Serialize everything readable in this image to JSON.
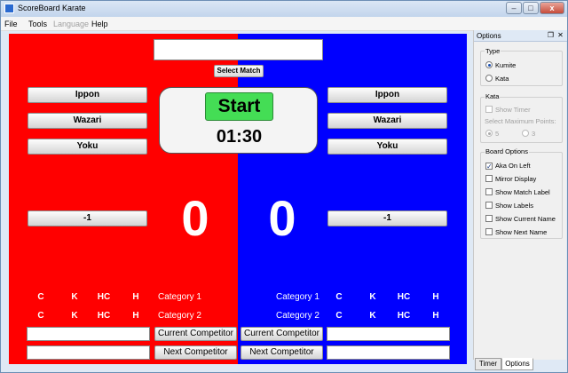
{
  "window": {
    "title": "ScoreBoard Karate",
    "min": "–",
    "max": "□",
    "close": "x"
  },
  "menu": {
    "file": "File",
    "tools": "Tools",
    "language": "Language",
    "help": "Help"
  },
  "board": {
    "select_match": "Select Match",
    "start": "Start",
    "timer": "01:30",
    "red": {
      "ippon": "Ippon",
      "wazari": "Wazari",
      "yoku": "Yoku",
      "minus": "-1",
      "score": "0",
      "penalties1": [
        "C",
        "K",
        "HC",
        "H"
      ],
      "penalties2": [
        "C",
        "K",
        "HC",
        "H"
      ],
      "category1": "Category 1",
      "category2": "Category 2",
      "current_button": "Current Competitor",
      "next_button": "Next Competitor"
    },
    "blue": {
      "ippon": "Ippon",
      "wazari": "Wazari",
      "yoku": "Yoku",
      "minus": "-1",
      "score": "0",
      "penalties1": [
        "C",
        "K",
        "HC",
        "H"
      ],
      "penalties2": [
        "C",
        "K",
        "HC",
        "H"
      ],
      "category1": "Category 1",
      "category2": "Category 2",
      "current_button": "Current Competitor",
      "next_button": "Next Competitor"
    },
    "colors": {
      "red": "#ff0000",
      "blue": "#0000ff",
      "start": "#44dd55"
    }
  },
  "options": {
    "title": "Options",
    "type_group": "Type",
    "kumite": "Kumite",
    "kata": "Kata",
    "kata_group": "Kata",
    "show_timer": "Show Timer",
    "max_points_label": "Select Maximum Points:",
    "points_5": "5",
    "points_3": "3",
    "board_group": "Board Options",
    "aka_on_left": "Aka On Left",
    "mirror": "Mirror Display",
    "show_match_label": "Show Match Label",
    "show_labels": "Show Labels",
    "show_current": "Show Current Name",
    "show_next": "Show Next Name"
  },
  "tabs": {
    "timer": "Timer",
    "options": "Options"
  }
}
